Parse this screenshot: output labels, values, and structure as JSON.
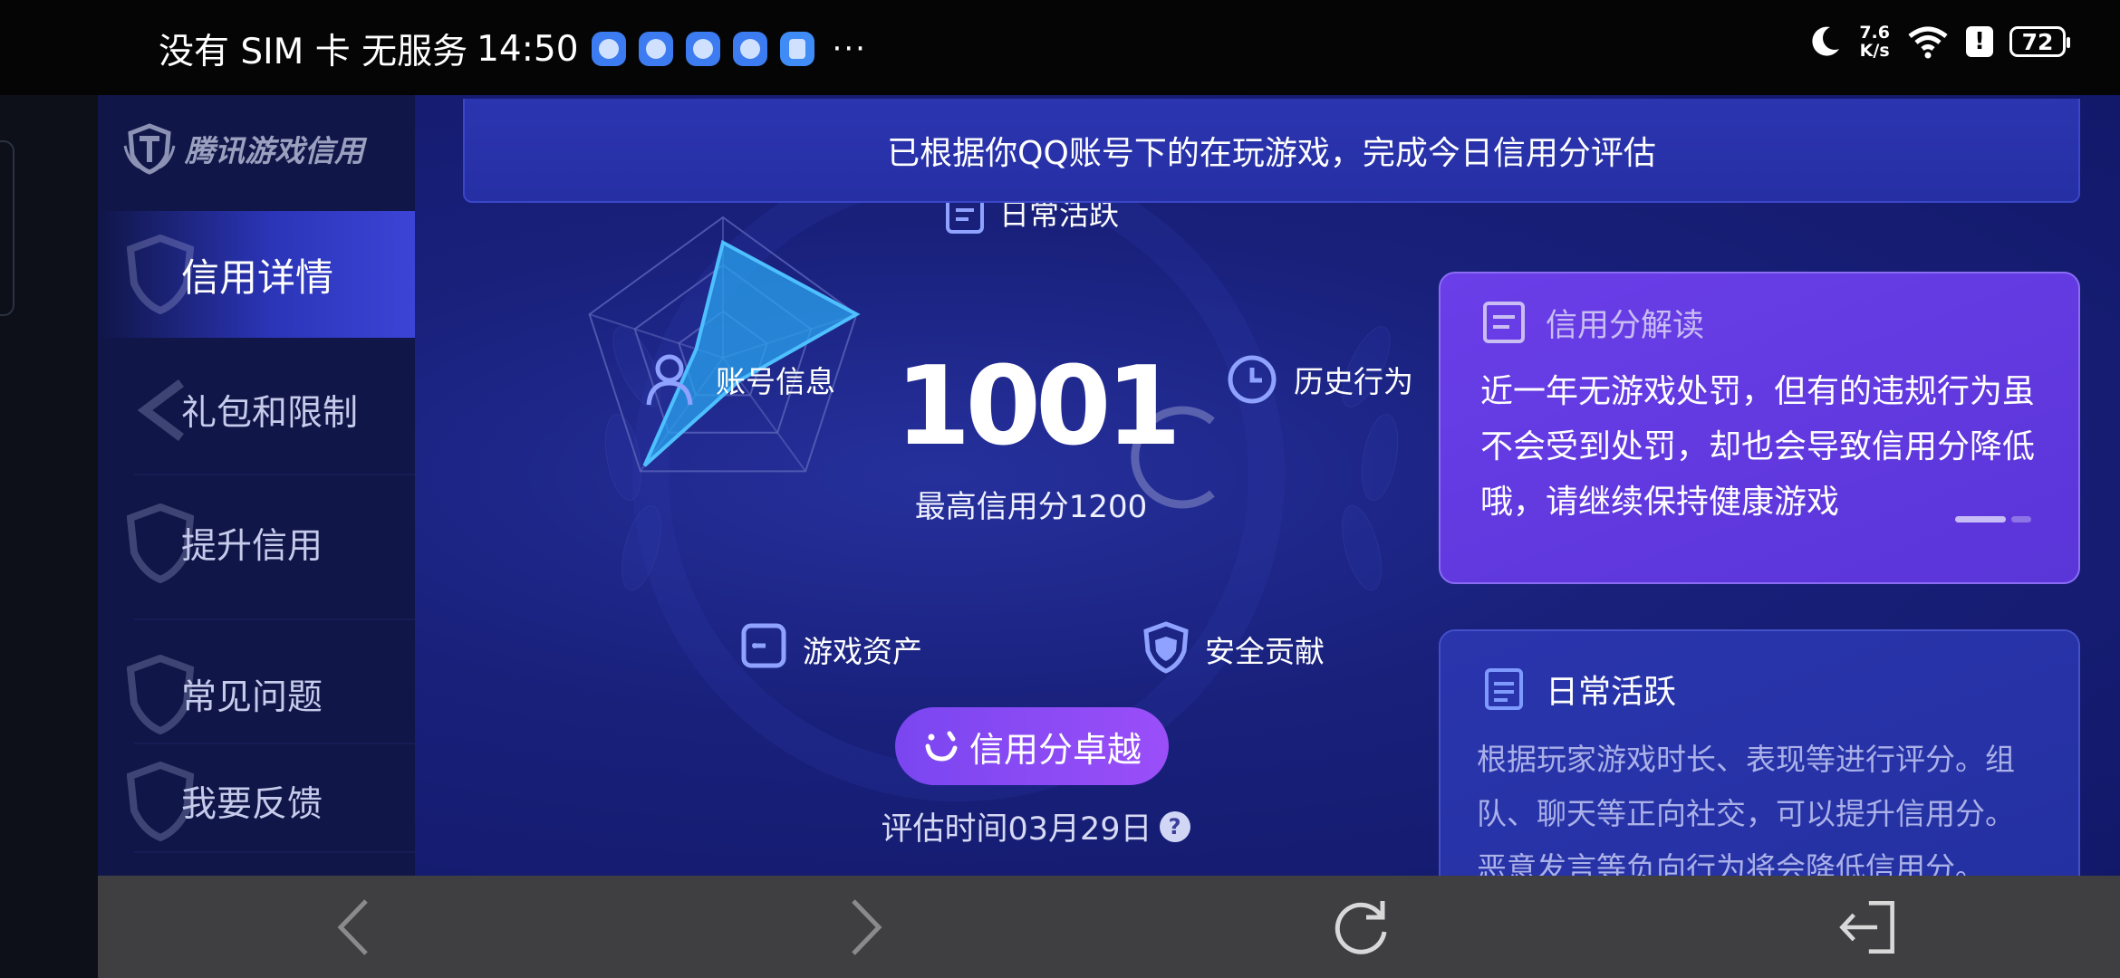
{
  "status_bar": {
    "carrier": "没有 SIM 卡 无服务",
    "time": "14:50",
    "more": "···",
    "net_speed_value": "7.6",
    "net_speed_unit": "K/s",
    "battery": "72",
    "alert": "!"
  },
  "sidebar": {
    "logo_text": "腾讯游戏信用",
    "items": [
      {
        "label": "信用详情",
        "active": true
      },
      {
        "label": "礼包和限制",
        "active": false
      },
      {
        "label": "提升信用",
        "active": false
      },
      {
        "label": "常见问题",
        "active": false
      },
      {
        "label": "我要反馈",
        "active": false
      }
    ]
  },
  "banner": {
    "text": "已根据你QQ账号下的在玩游戏，完成今日信用分评估"
  },
  "radar": {
    "score": "1001",
    "max_score": "最高信用分1200",
    "dimensions": [
      {
        "label": "日常活跃",
        "icon": "document-icon",
        "value": 0.82
      },
      {
        "label": "历史行为",
        "icon": "clock-icon",
        "value": 1.0
      },
      {
        "label": "安全贡献",
        "icon": "shield-icon",
        "value": 0.2
      },
      {
        "label": "游戏资产",
        "icon": "wallet-icon",
        "value": 0.95
      },
      {
        "label": "账号信息",
        "icon": "user-icon",
        "value": 0.2
      }
    ]
  },
  "badge_button": {
    "label": "信用分卓越",
    "icon": "smile-icon"
  },
  "eval_time": {
    "label": "评估时间03月29日",
    "help": "?"
  },
  "card_interpret": {
    "title": "信用分解读",
    "body": "近一年无游戏处罚，但有的违规行为虽不会受到处罚，却也会导致信用分降低哦，请继续保持健康游戏"
  },
  "card_daily": {
    "title": "日常活跃",
    "body": "根据玩家游戏时长、表现等进行评分。组队、聊天等正向社交，可以提升信用分。恶意发言等负向行为将会降低信用分。"
  },
  "colors": {
    "background": "#18207a",
    "sidebar": "#101648",
    "accent_purple": "#6a3ee8",
    "radar_fill": "#2aa3ef",
    "bottom_bar": "#3f3f41"
  },
  "bottom_nav": [
    "back-icon",
    "forward-icon",
    "refresh-icon",
    "exit-icon"
  ]
}
